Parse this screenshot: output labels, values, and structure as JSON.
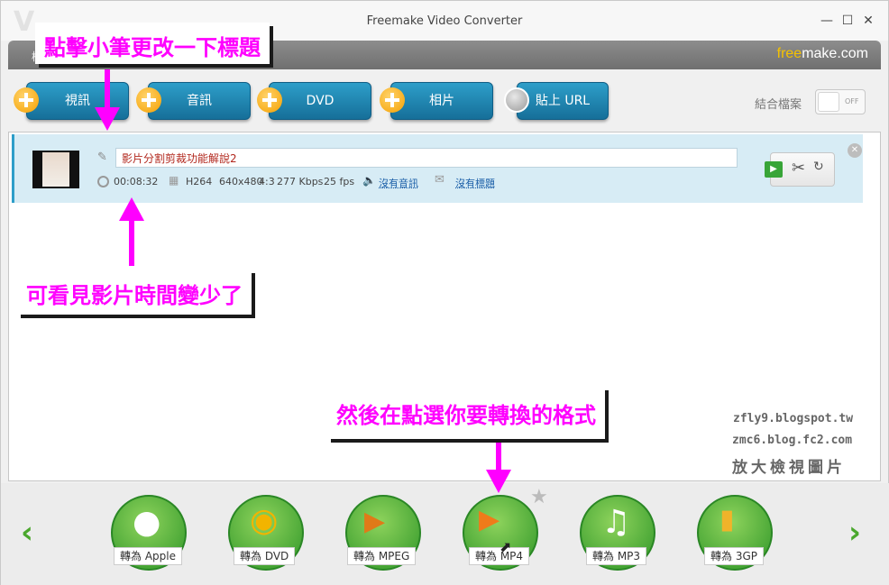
{
  "window": {
    "title": "Freemake Video Converter",
    "brand_free": "free",
    "brand_make": "make.com",
    "menu_first": "檔"
  },
  "toolbar": {
    "video": "視訊",
    "audio": "音訊",
    "dvd": "DVD",
    "photo": "相片",
    "paste_url": "貼上 URL",
    "merge_files": "結合檔案",
    "toggle_state": "OFF"
  },
  "file": {
    "title": "影片分割剪裁功能解說2",
    "duration": "00:08:32",
    "codec": "H264",
    "resolution": "640x480",
    "aspect": "4:3",
    "bitrate": "277 Kbps",
    "fps": "25 fps",
    "audio_link": "沒有音訊",
    "subtitle_link": "沒有標題"
  },
  "formats": [
    {
      "label": "轉為 Apple",
      "icon": "apple-icon"
    },
    {
      "label": "轉為 DVD",
      "icon": "disc-icon"
    },
    {
      "label": "轉為 MPEG",
      "icon": "tv-icon"
    },
    {
      "label": "轉為 MP4",
      "icon": "mp4-device-icon"
    },
    {
      "label": "轉為 MP3",
      "icon": "headphones-icon"
    },
    {
      "label": "轉為 3GP",
      "icon": "phone-icon"
    }
  ],
  "annotations": {
    "top": "點擊小筆更改一下標題",
    "middle": "可看見影片時間變少了",
    "bottom": "然後在點選你要轉換的格式"
  },
  "watermark": {
    "line1": "zfly9.blogspot.tw",
    "line2": "zmc6.blog.fc2.com",
    "line3": "放大檢視圖片"
  },
  "colors": {
    "accent_blue": "#1f86b5",
    "format_green": "#3aa32f",
    "annotation_magenta": "#ff00ff"
  }
}
